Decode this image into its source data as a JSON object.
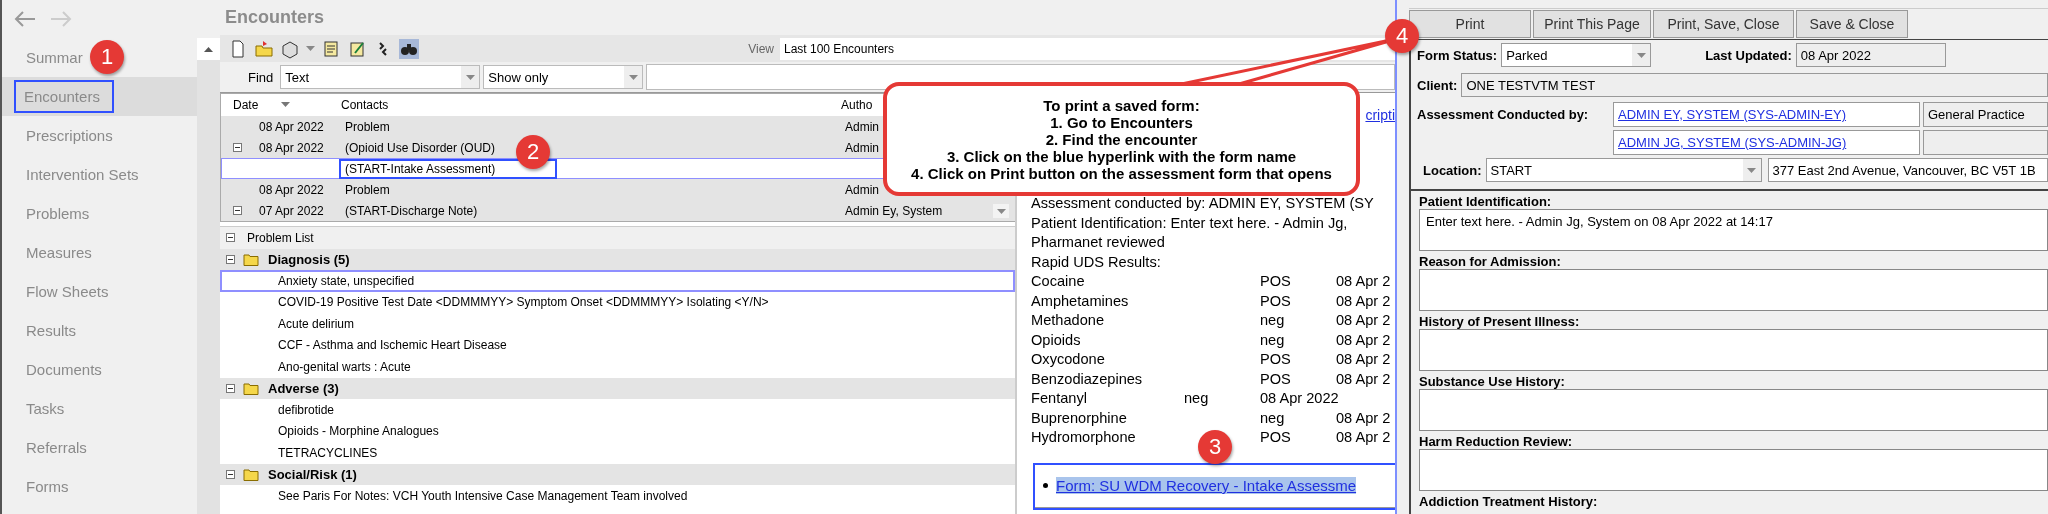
{
  "nav": {
    "items": [
      {
        "label": "Summar",
        "selected": false,
        "highlighted": false
      },
      {
        "label": "Encounters",
        "selected": true,
        "highlighted": true
      },
      {
        "label": "Prescriptions",
        "selected": false,
        "highlighted": false
      },
      {
        "label": "Intervention Sets",
        "selected": false,
        "highlighted": false
      },
      {
        "label": "Problems",
        "selected": false,
        "highlighted": false
      },
      {
        "label": "Measures",
        "selected": false,
        "highlighted": false
      },
      {
        "label": "Flow Sheets",
        "selected": false,
        "highlighted": false
      },
      {
        "label": "Results",
        "selected": false,
        "highlighted": false
      },
      {
        "label": "Documents",
        "selected": false,
        "highlighted": false
      },
      {
        "label": "Tasks",
        "selected": false,
        "highlighted": false
      },
      {
        "label": "Referrals",
        "selected": false,
        "highlighted": false
      },
      {
        "label": "Forms",
        "selected": false,
        "highlighted": false
      }
    ]
  },
  "panel_title": "Encounters",
  "toolbar": {
    "view_label": "View",
    "view_value": "Last 100 Encounters"
  },
  "find": {
    "label": "Find",
    "field": "Text",
    "scope": "Show only"
  },
  "encounters": {
    "columns": [
      "Date",
      "Contacts",
      "Autho"
    ],
    "rows": [
      {
        "kind": "entry",
        "date": "08 Apr 2022",
        "contact": "Problem",
        "author": "Admin",
        "selected": false,
        "highlighted": false
      },
      {
        "kind": "group",
        "date": "08 Apr 2022",
        "contact": "(Opioid Use Disorder (OUD)",
        "author": "Admin",
        "selected": false,
        "highlighted": false
      },
      {
        "kind": "child",
        "contact": "(START-Intake Assessment)",
        "selected": true,
        "highlighted": true
      },
      {
        "kind": "entry",
        "date": "08 Apr 2022",
        "contact": "Problem",
        "author": "Admin",
        "selected": false,
        "highlighted": false
      },
      {
        "kind": "group",
        "date": "07 Apr 2022",
        "contact": "(START-Discharge Note)",
        "author": "Admin Ey, System",
        "selected": false,
        "highlighted": false
      }
    ]
  },
  "problem_list": {
    "title": "Problem List",
    "groups": [
      {
        "label": "Diagnosis (5)",
        "items": [
          {
            "label": "Anxiety state, unspecified",
            "selected": true
          },
          {
            "label": "COVID-19 Positive Test Date <DDMMMYY> Symptom Onset <DDMMMYY> Isolating <Y/N>",
            "selected": false
          },
          {
            "label": "Acute delirium",
            "selected": false
          },
          {
            "label": "CCF - Asthma and Ischemic Heart Disease",
            "selected": false
          },
          {
            "label": "Ano-genital warts : Acute",
            "selected": false
          }
        ]
      },
      {
        "label": "Adverse (3)",
        "items": [
          {
            "label": "defibrotide",
            "selected": false
          },
          {
            "label": "Opioids - Morphine Analogues",
            "selected": false
          },
          {
            "label": "TETRACYCLINES",
            "selected": false
          }
        ]
      },
      {
        "label": "Social/Risk (1)",
        "items": [
          {
            "label": "See Paris For Notes: VCH Youth Intensive Case Management Team involved",
            "selected": false
          }
        ]
      }
    ]
  },
  "document": {
    "top_link": "cripti",
    "author_line": "Assessment conducted by: ADMIN EY, SYSTEM (SY",
    "lines": [
      "Patient Identification: Enter text here.  - Admin Jg,",
      "Pharmanet reviewed",
      "Rapid UDS Results:"
    ],
    "results": [
      {
        "kind": "aligned",
        "name": "Cocaine",
        "value": "POS",
        "date": "08 Apr 2"
      },
      {
        "kind": "aligned",
        "name": "Amphetamines",
        "value": "POS",
        "date": "08 Apr 2"
      },
      {
        "kind": "aligned",
        "name": "Methadone",
        "value": "neg",
        "date": "08 Apr 2"
      },
      {
        "kind": "aligned",
        "name": "Opioids",
        "value": "neg",
        "date": "08 Apr 2"
      },
      {
        "kind": "aligned",
        "name": "Oxycodone",
        "value": "POS",
        "date": "08 Apr 2"
      },
      {
        "kind": "aligned",
        "name": "Benzodiazepines",
        "value": "POS",
        "date": "08 Apr 2"
      },
      {
        "kind": "shifted",
        "name": "Fentanyl",
        "value": "neg",
        "date": "08 Apr 2022"
      },
      {
        "kind": "aligned",
        "name": "Buprenorphine",
        "value": "neg",
        "date": "08 Apr 2"
      },
      {
        "kind": "aligned",
        "name": "Hydromorphone",
        "value": "POS",
        "date": "08 Apr 2"
      }
    ],
    "form_link": {
      "label": "Form: SU WDM Recovery - Intake Assessme",
      "highlighted": true
    }
  },
  "form": {
    "buttons": [
      "Print",
      "Print This Page",
      "Print, Save, Close",
      "Save & Close"
    ],
    "status_label": "Form Status:",
    "status": "Parked",
    "updated_label": "Last Updated:",
    "updated": "08 Apr 2022",
    "client_label": "Client:",
    "client": "ONE TESTVTM TEST",
    "assessor_label": "Assessment Conducted by:",
    "assessors": [
      {
        "name": "ADMIN EY, SYSTEM (SYS-ADMIN-EY)",
        "specialty": "General Practice"
      },
      {
        "name": "ADMIN JG, SYSTEM (SYS-ADMIN-JG)"
      }
    ],
    "location_label": "Location:",
    "location": "START",
    "address": "377 East 2nd Avenue, Vancouver, BC V5T 1B",
    "sections": [
      {
        "kind": "textbox",
        "label": "Patient Identification:",
        "value": "Enter text here.  - Admin Jg, System on 08 Apr 2022 at 14:17"
      },
      {
        "kind": "textbox",
        "label": "Reason for Admission:"
      },
      {
        "kind": "textbox",
        "label": "History of Present Illness:"
      },
      {
        "kind": "textbox",
        "label": "Substance Use History:"
      },
      {
        "kind": "textbox",
        "label": "Harm Reduction Review:"
      },
      {
        "kind": "label",
        "label": "Addiction Treatment History:"
      }
    ]
  },
  "annotations": {
    "badges": [
      "1",
      "2",
      "3",
      "4"
    ],
    "callout": [
      "To print a saved form:",
      "1. Go to Encounters",
      "2. Find the encounter",
      "3. Click on the blue hyperlink with the form name",
      "4. Click on Print button on the assessment form that opens"
    ]
  }
}
